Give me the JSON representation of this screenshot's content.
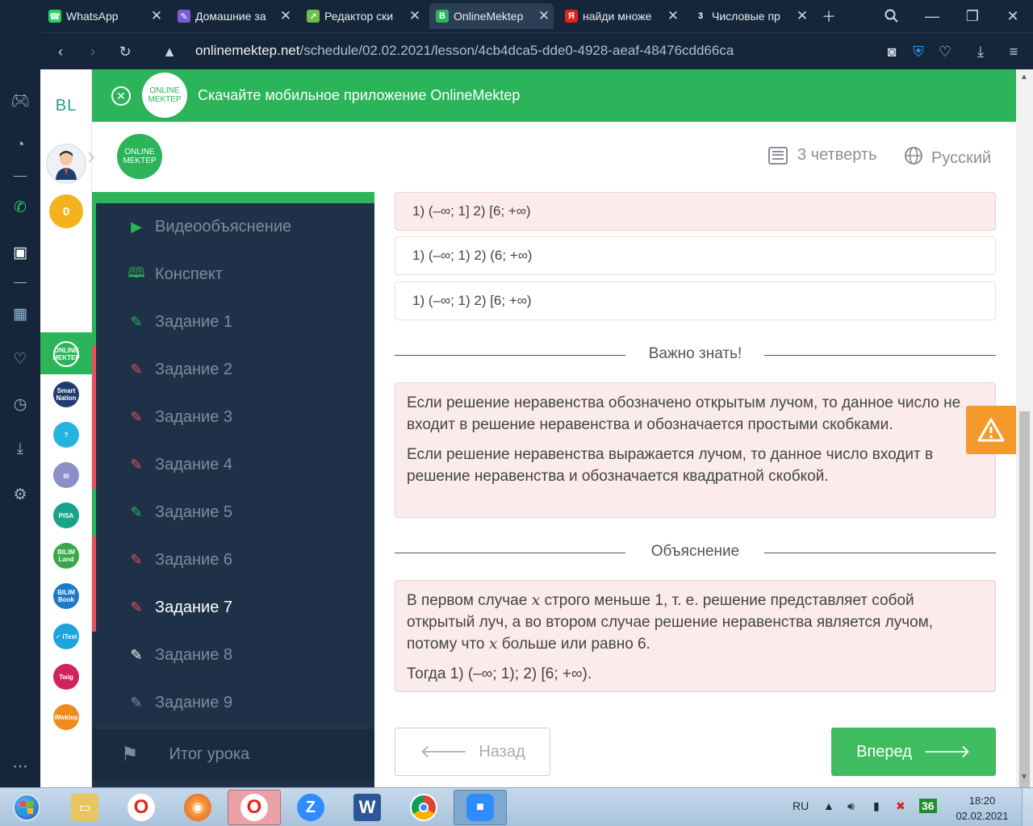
{
  "browser": {
    "tabs": [
      {
        "title": "WhatsApp",
        "icon": "whatsapp-icon",
        "color": "#25d366",
        "glyph": "☎",
        "active": false
      },
      {
        "title": "Домашние за",
        "icon": "homework-icon",
        "color": "#7b5cd6",
        "glyph": "✎",
        "active": false
      },
      {
        "title": "Редактор ски",
        "icon": "editor-icon",
        "color": "#6cc04a",
        "glyph": "↗",
        "active": false
      },
      {
        "title": "OnlineMektep",
        "icon": "onlinemektep-icon",
        "color": "#2bb45a",
        "glyph": "B",
        "active": true
      },
      {
        "title": "найди множе",
        "icon": "yandex-icon",
        "color": "#e2231a",
        "glyph": "Я",
        "active": false
      },
      {
        "title": "Числовые пр",
        "icon": "number-icon",
        "color": "#15263a",
        "glyph": "3",
        "active": false
      }
    ],
    "url_host": "onlinemektep.net",
    "url_path": "/schedule/02.02.2021/lesson/4cb4dca5-dde0-4928-aeaf-48476cdd66ca"
  },
  "site": {
    "rail_logo": "BL",
    "score": "0",
    "banner_text": "Скачайте мобильное приложение OnlineMektep",
    "logo_line1": "ONLINE",
    "logo_line2": "MEKTEP",
    "quarter": "3 четверть",
    "language": "Русский"
  },
  "rail_apps": [
    {
      "label": "ONLINE MEKTEP",
      "color": "#2bb45a"
    },
    {
      "label": "Smart Nation",
      "color": "#1f3e6e"
    },
    {
      "label": "?",
      "color": "#25b4e0"
    },
    {
      "label": "▤",
      "color": "#8d8fc7"
    },
    {
      "label": "PISA",
      "color": "#1aa38b"
    },
    {
      "label": "BILIM Land",
      "color": "#3aa84a"
    },
    {
      "label": "BILIM Book",
      "color": "#1c78c8"
    },
    {
      "label": "✓ iTest",
      "color": "#1da3e0"
    },
    {
      "label": "Twig",
      "color": "#d2245c"
    },
    {
      "label": "iMektep",
      "color": "#f08a1c"
    }
  ],
  "lesson_nav": {
    "items": [
      {
        "label": "Видеообъяснение",
        "icon": "play-icon",
        "glyph": "▶",
        "icon_color": "#2bb45a",
        "status": "#2bb45a",
        "current": false
      },
      {
        "label": "Конспект",
        "icon": "book-icon",
        "glyph": "🕮",
        "icon_color": "#2bb45a",
        "status": "#2bb45a",
        "current": false
      },
      {
        "label": "Задание 1",
        "icon": "edit-icon",
        "glyph": "✎",
        "icon_color": "#2bb45a",
        "status": "#2bb45a",
        "current": false
      },
      {
        "label": "Задание 2",
        "icon": "edit-icon",
        "glyph": "✎",
        "icon_color": "#e8505b",
        "status": "#e8505b",
        "current": false
      },
      {
        "label": "Задание 3",
        "icon": "edit-icon",
        "glyph": "✎",
        "icon_color": "#e8505b",
        "status": "#e8505b",
        "current": false
      },
      {
        "label": "Задание 4",
        "icon": "edit-icon",
        "glyph": "✎",
        "icon_color": "#e8505b",
        "status": "#e8505b",
        "current": false
      },
      {
        "label": "Задание 5",
        "icon": "edit-icon",
        "glyph": "✎",
        "icon_color": "#2bb45a",
        "status": "#2bb45a",
        "current": false
      },
      {
        "label": "Задание 6",
        "icon": "edit-icon",
        "glyph": "✎",
        "icon_color": "#e8505b",
        "status": "#e8505b",
        "current": false
      },
      {
        "label": "Задание 7",
        "icon": "edit-icon",
        "glyph": "✎",
        "icon_color": "#e8505b",
        "status": "#e8505b",
        "current": true
      },
      {
        "label": "Задание 8",
        "icon": "edit-icon",
        "glyph": "✎",
        "icon_color": "#ffffff",
        "status": "",
        "current": false
      },
      {
        "label": "Задание 9",
        "icon": "edit-icon",
        "glyph": "✎",
        "icon_color": "#7e8c9b",
        "status": "",
        "current": false
      }
    ],
    "final_label": "Итог урока"
  },
  "options": [
    {
      "text": "1) (–∞; 1] 2) [6; +∞)",
      "selected": true
    },
    {
      "text": "1) (–∞; 1) 2) (6; +∞)",
      "selected": false
    },
    {
      "text": "1) (–∞; 1) 2) [6; +∞)",
      "selected": false
    }
  ],
  "important": {
    "title": "Важно знать!",
    "p1": "Если решение неравенства обозначено открытым лучом, то данное число не входит в решение неравенства и обозначается простыми скобками.",
    "p2": "Если решение неравенства выражается лучом, то данное число входит в решение неравенства и обозначается квадратной скобкой."
  },
  "explanation": {
    "title": "Объяснение",
    "var": "x",
    "p1_a": "В первом случае",
    "p1_b": "строго меньше 1, т. е. решение представляет собой открытый луч, а во втором случае решение неравенства является лучом, потому что",
    "p1_c": "больше или равно 6.",
    "p2": "Тогда 1) (–∞; 1); 2) [6; +∞)."
  },
  "buttons": {
    "back": "Назад",
    "next": "Вперед"
  },
  "taskbar": {
    "lang": "RU",
    "time": "18:20",
    "date": "02.02.2021",
    "tray_badge": "36"
  },
  "colors": {
    "brand_green": "#2bb45a",
    "nav_dark": "#1e3148",
    "error_red": "#e8505b",
    "warning_orange": "#f39a2b",
    "opera_dark": "#15263a"
  }
}
